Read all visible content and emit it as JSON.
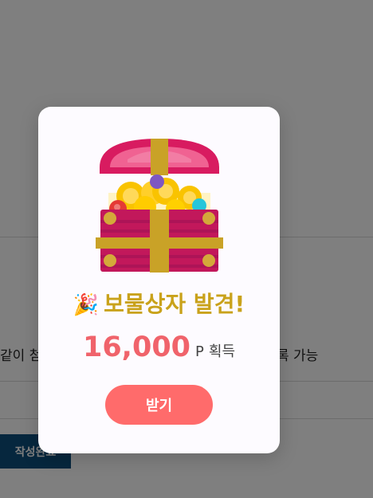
{
  "background": {
    "hint_text_left": "같이 첨",
    "hint_text_right": "록 가능",
    "submit_label": "작성완료"
  },
  "modal": {
    "title": "보물상자 발견!",
    "title_emoji": "🎉",
    "amount": "16,000",
    "unit": "P",
    "earn_label": "획득",
    "receive_label": "받기",
    "icon": "treasure-chest-icon"
  },
  "colors": {
    "title": "#c9a21b",
    "amount": "#f0636b",
    "button": "#ff6b6b",
    "submit_button": "#0d4f7c"
  }
}
